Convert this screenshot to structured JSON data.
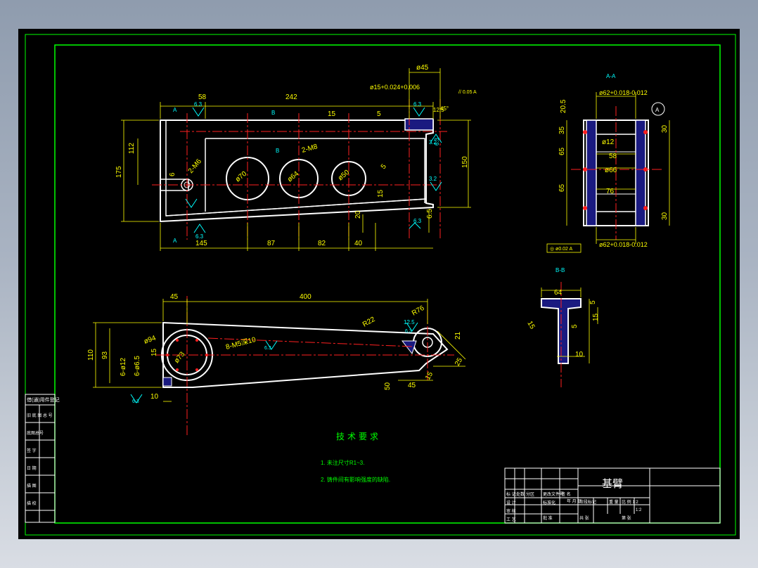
{
  "drawing": {
    "title_block": {
      "part_name": "基臂",
      "scale_left": "比 例 1:2",
      "scale_right": "1:2",
      "row_labels": [
        "标 记",
        "处数",
        "分区",
        "更改文件号",
        "签 名",
        "年 月 日"
      ],
      "design_label": "设 计",
      "check_label": "审 核",
      "craft_label": "工 艺",
      "std_label": "标准化",
      "approve_label": "批 准",
      "weight_label": "重 量",
      "stage_label": "阶段标记",
      "sheet_label": "共  张",
      "sheet_of_label": "第  张"
    },
    "tech_req": {
      "heading": "技术要求",
      "items": [
        "1. 未注尺寸R1~3.",
        "2. 铸件间有影响强度的缺陷."
      ]
    },
    "side_table": [
      "借(通)用件登记",
      "旧 底 图 总 号",
      "底图总号",
      "签 字",
      "日 期",
      "描 图",
      "描 校"
    ],
    "front_view": {
      "dims": [
        "58",
        "242",
        "ø45",
        "ø15+0.024+0.006",
        "// 0.05 A",
        "5",
        "15",
        "12.5",
        "112",
        "175",
        "150",
        "145",
        "87",
        "82",
        "40",
        "20",
        "15",
        "6.5",
        "6",
        "2-M6",
        "2-M8",
        "ø70",
        "ø64",
        "ø50",
        "5",
        "45°"
      ],
      "roughness": [
        "6.3",
        "6.3",
        "6.3",
        "3.2",
        "3.2",
        "6.3",
        "6.3"
      ],
      "section_marks": [
        "A",
        "A",
        "B",
        "B"
      ]
    },
    "side_view": {
      "label": "A-A",
      "dims": [
        "ø62+0.018-0.012",
        "20.5",
        "35",
        "65",
        "65",
        "30",
        "30",
        "ø12",
        "58",
        "ø66",
        "76",
        "ø62+0.018-0.012",
        "◎ ø0.02 A",
        "A"
      ]
    },
    "section_b": {
      "label": "B-B",
      "dims": [
        "64",
        "15",
        "5",
        "15",
        "5",
        "10"
      ]
    },
    "bottom_view": {
      "dims": [
        "45",
        "400",
        "R76",
        "R22",
        "12.5",
        "ø94",
        "ø73",
        "8-M5深10",
        "6-ø12",
        "6-ø6.5",
        "110",
        "93",
        "15",
        "10",
        "50",
        "45",
        "15",
        "21",
        "25",
        "6.3",
        "6.3",
        "6.3"
      ]
    }
  }
}
